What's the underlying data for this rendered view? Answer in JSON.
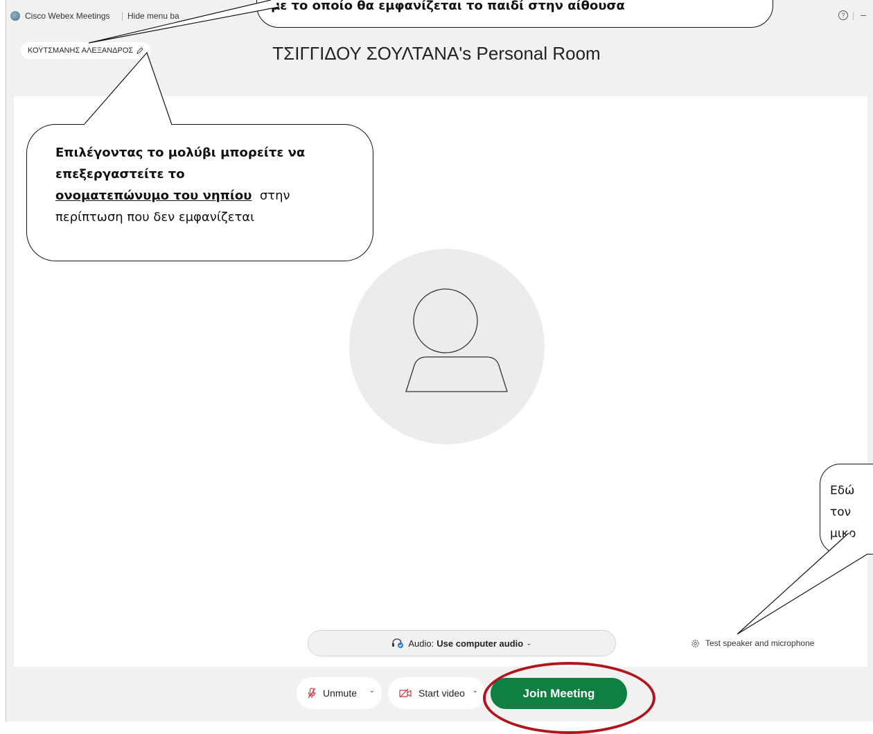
{
  "titlebar": {
    "app_title": "Cisco Webex Meetings",
    "hide_menu_label": "Hide menu ba",
    "help_icon": "question-circle-icon"
  },
  "user": {
    "display_name": "ΚΟΥΤΣΜΑΝΗΣ ΑΛΕΞΑΝΔΡΟΣ"
  },
  "room": {
    "title": "ΤΣΙΓΓΙΔΟΥ ΣΟΥΛΤΑΝΑ's Personal Room"
  },
  "audio": {
    "label": "Audio:",
    "value": "Use computer audio"
  },
  "test_link": "Test speaker and microphone",
  "controls": {
    "unmute_label": "Unmute",
    "start_video_label": "Start video",
    "join_label": "Join Meeting"
  },
  "callouts": {
    "top_text": "με το οποίο θα εμφανίζεται το παιδί στην αίθουσα",
    "mid_bold": "Επιλέγοντας το μολύβι μπορείτε να επεξεργαστείτε το",
    "mid_underlined": "ονοματεπώνυμο του νηπίου",
    "mid_rest": "στην περίπτωση που δεν εμφανίζεται",
    "right_lines": [
      "Εδώ",
      "τον",
      "μικρ"
    ]
  },
  "colors": {
    "join_button": "#0f8041",
    "highlight_ellipse": "#b1151c",
    "window_bg": "#f1f1f1"
  }
}
